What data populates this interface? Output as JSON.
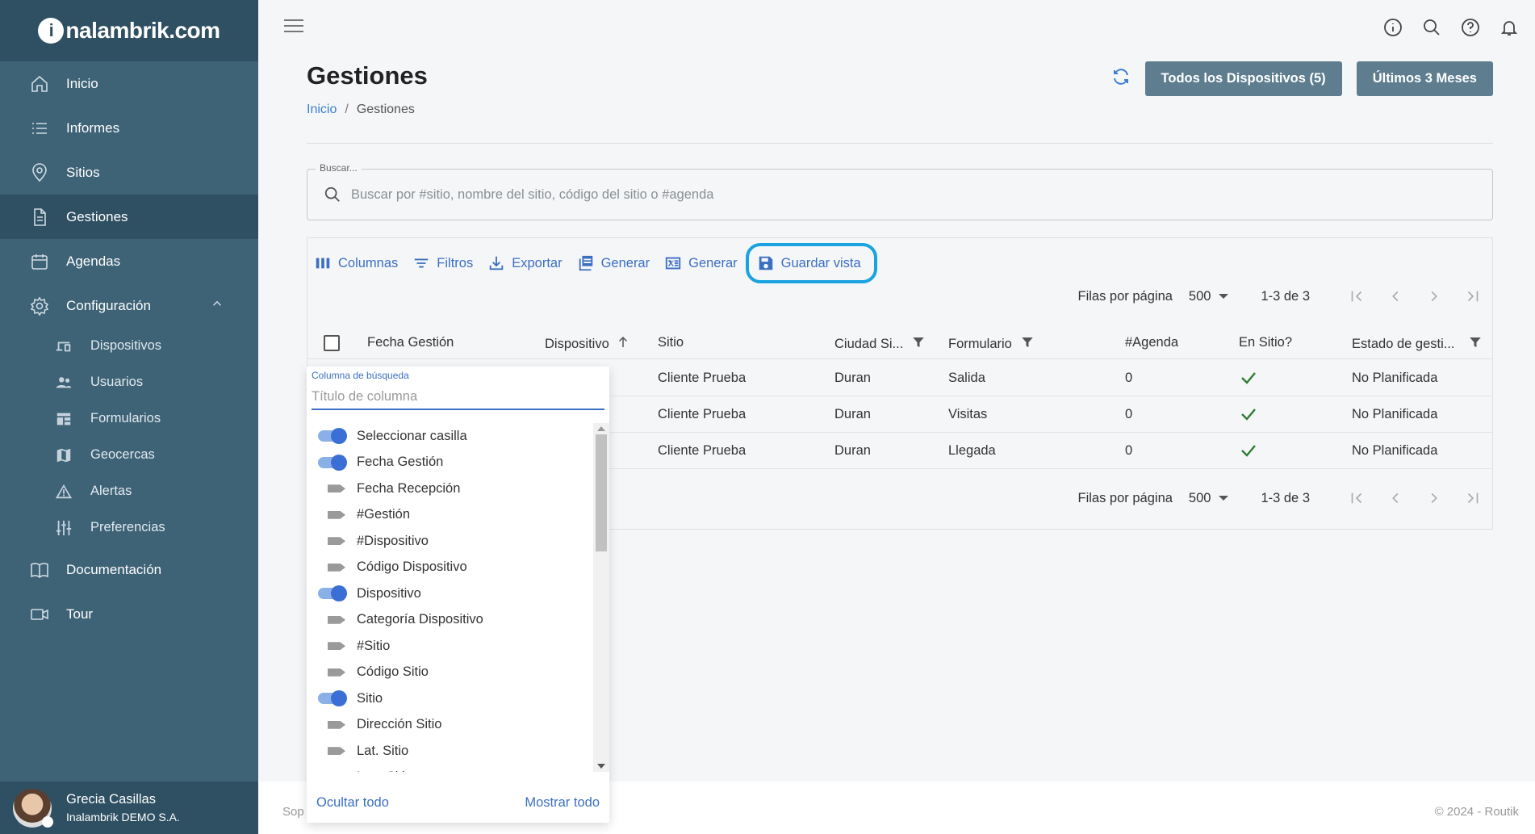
{
  "brand": {
    "logo_letter": "i",
    "logo_text": "nalambrik.com"
  },
  "sidebar": {
    "items": [
      {
        "label": "Inicio",
        "icon": "home-icon"
      },
      {
        "label": "Informes",
        "icon": "list-icon"
      },
      {
        "label": "Sitios",
        "icon": "map-pin-icon"
      },
      {
        "label": "Gestiones",
        "icon": "document-icon",
        "active": true
      },
      {
        "label": "Agendas",
        "icon": "calendar-icon"
      },
      {
        "label": "Configuración",
        "icon": "gear-icon",
        "expanded": true
      }
    ],
    "sub_items": [
      {
        "label": "Dispositivos",
        "icon": "devices-icon"
      },
      {
        "label": "Usuarios",
        "icon": "users-icon"
      },
      {
        "label": "Formularios",
        "icon": "forms-icon"
      },
      {
        "label": "Geocercas",
        "icon": "map-icon"
      },
      {
        "label": "Alertas",
        "icon": "warning-icon"
      },
      {
        "label": "Preferencias",
        "icon": "sliders-icon"
      }
    ],
    "bottom_items": [
      {
        "label": "Documentación",
        "icon": "book-icon"
      },
      {
        "label": "Tour",
        "icon": "video-icon"
      }
    ],
    "user": {
      "name": "Grecia Casillas",
      "org": "Inalambrik DEMO S.A."
    }
  },
  "header": {
    "title": "Gestiones",
    "breadcrumb": {
      "home": "Inicio",
      "current": "Gestiones"
    },
    "devices_button": "Todos los Dispositivos (5)",
    "period_button": "Últimos 3 Meses"
  },
  "search": {
    "legend": "Buscar...",
    "placeholder": "Buscar por #sitio, nombre del sitio, código del sitio o #agenda",
    "value": ""
  },
  "toolbar": {
    "columns": "Columnas",
    "filters": "Filtros",
    "export": "Exportar",
    "generate_pdf": "Generar",
    "generate_excel": "Generar",
    "save_view": "Guardar vista"
  },
  "pagination": {
    "rows_label": "Filas por página",
    "rows_value": "500",
    "range": "1-3 de 3"
  },
  "table": {
    "columns": [
      "Fecha Gestión",
      "Dispositivo",
      "Sitio",
      "Ciudad Si...",
      "Formulario",
      "#Agenda",
      "En Sitio?",
      "Estado de gesti..."
    ],
    "rows": [
      {
        "sitio": "Cliente Prueba",
        "ciudad": "Duran",
        "formulario": "Salida",
        "agenda": "0",
        "en_sitio": true,
        "estado": "No Planificada"
      },
      {
        "sitio": "Cliente Prueba",
        "ciudad": "Duran",
        "formulario": "Visitas",
        "agenda": "0",
        "en_sitio": true,
        "estado": "No Planificada"
      },
      {
        "sitio": "Cliente Prueba",
        "ciudad": "Duran",
        "formulario": "Llegada",
        "agenda": "0",
        "en_sitio": true,
        "estado": "No Planificada"
      }
    ]
  },
  "column_picker": {
    "label": "Columna de búsqueda",
    "placeholder": "Título de columna",
    "options": [
      {
        "label": "Seleccionar casilla",
        "on": true
      },
      {
        "label": "Fecha Gestión",
        "on": true
      },
      {
        "label": "Fecha Recepción",
        "on": false
      },
      {
        "label": "#Gestión",
        "on": false
      },
      {
        "label": "#Dispositivo",
        "on": false
      },
      {
        "label": "Código Dispositivo",
        "on": false
      },
      {
        "label": "Dispositivo",
        "on": true
      },
      {
        "label": "Categoría Dispositivo",
        "on": false
      },
      {
        "label": "#Sitio",
        "on": false
      },
      {
        "label": "Código Sitio",
        "on": false
      },
      {
        "label": "Sitio",
        "on": true
      },
      {
        "label": "Dirección Sitio",
        "on": false
      },
      {
        "label": "Lat. Sitio",
        "on": false
      },
      {
        "label": "Lon. Sitio",
        "on": false
      }
    ],
    "hide_all": "Ocultar todo",
    "show_all": "Mostrar todo"
  },
  "footer": {
    "support_partial": "Sop",
    "copyright": "© 2024 - Routik"
  },
  "colors": {
    "sidebar": "#3e6276",
    "sidebar_dark": "#2f5063",
    "accent": "#3b6fc1",
    "highlight_ring": "#1aa3e0",
    "button": "#5e7e90",
    "check": "#2e7d32"
  }
}
